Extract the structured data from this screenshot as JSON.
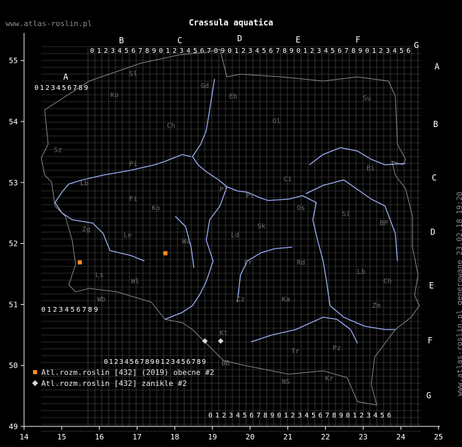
{
  "header": {
    "site": "www.atlas-roslin.pl",
    "title": "Crassula aquatica",
    "generated": "www.atlas-roslin.pl generowane 23.02.18 19:20"
  },
  "axes": {
    "lon_labels": [
      "14",
      "15",
      "16",
      "17",
      "18",
      "19",
      "20",
      "21",
      "22",
      "23",
      "24",
      "25"
    ],
    "lat_labels": [
      "49",
      "50",
      "51",
      "52",
      "53",
      "54",
      "55"
    ],
    "axis_color": "#ffffff"
  },
  "grid": {
    "color": "#5a5a5a",
    "column_letters": [
      "A",
      "B",
      "C",
      "D",
      "E",
      "F",
      "G"
    ],
    "row_letters": [
      "A",
      "B",
      "C",
      "D",
      "E",
      "F",
      "G"
    ],
    "digits": "0123456789"
  },
  "regions": [
    {
      "code": "Sl",
      "lon": 16.9,
      "lat": 54.75
    },
    {
      "code": "Gd",
      "lon": 18.8,
      "lat": 54.55
    },
    {
      "code": "Eb",
      "lon": 19.55,
      "lat": 54.38
    },
    {
      "code": "Su",
      "lon": 23.1,
      "lat": 54.35
    },
    {
      "code": "Ko",
      "lon": 16.4,
      "lat": 54.4
    },
    {
      "code": "Ol",
      "lon": 20.7,
      "lat": 53.97
    },
    {
      "code": "Ch",
      "lon": 17.9,
      "lat": 53.9
    },
    {
      "code": "Sz",
      "lon": 14.9,
      "lat": 53.5
    },
    {
      "code": "Pi",
      "lon": 16.9,
      "lat": 53.27
    },
    {
      "code": "Ci",
      "lon": 21.0,
      "lat": 53.02
    },
    {
      "code": "Bi",
      "lon": 23.2,
      "lat": 53.2
    },
    {
      "code": "Lb",
      "lon": 15.6,
      "lat": 52.95
    },
    {
      "code": "Pl",
      "lon": 19.3,
      "lat": 52.85
    },
    {
      "code": "Pt",
      "lon": 20.0,
      "lat": 52.75
    },
    {
      "code": "Fi",
      "lon": 16.9,
      "lat": 52.7
    },
    {
      "code": "Ko",
      "lon": 17.5,
      "lat": 52.55
    },
    {
      "code": "Os",
      "lon": 21.35,
      "lat": 52.55
    },
    {
      "code": "Si",
      "lon": 22.55,
      "lat": 52.45
    },
    {
      "code": "BP",
      "lon": 23.55,
      "lat": 52.3
    },
    {
      "code": "Sk",
      "lon": 20.3,
      "lat": 52.25
    },
    {
      "code": "Zg",
      "lon": 15.65,
      "lat": 52.2
    },
    {
      "code": "Le",
      "lon": 16.75,
      "lat": 52.1
    },
    {
      "code": "Ld",
      "lon": 19.6,
      "lat": 52.1
    },
    {
      "code": "Wa",
      "lon": 18.3,
      "lat": 52.0
    },
    {
      "code": "Pr",
      "lon": 19.95,
      "lat": 51.65
    },
    {
      "code": "Rd",
      "lon": 21.35,
      "lat": 51.65
    },
    {
      "code": "Lb",
      "lon": 22.95,
      "lat": 51.5
    },
    {
      "code": "Ls",
      "lon": 16.0,
      "lat": 51.45
    },
    {
      "code": "Wl",
      "lon": 16.95,
      "lat": 51.35
    },
    {
      "code": "Ch",
      "lon": 23.65,
      "lat": 51.35
    },
    {
      "code": "Wb",
      "lon": 16.05,
      "lat": 51.05
    },
    {
      "code": "Cz",
      "lon": 19.75,
      "lat": 51.05
    },
    {
      "code": "Ka",
      "lon": 20.95,
      "lat": 51.05
    },
    {
      "code": "Zm",
      "lon": 23.35,
      "lat": 50.95
    },
    {
      "code": "Kt",
      "lon": 19.3,
      "lat": 50.5
    },
    {
      "code": "Tr",
      "lon": 21.2,
      "lat": 50.2
    },
    {
      "code": "Pz",
      "lon": 22.3,
      "lat": 50.25
    },
    {
      "code": "BB",
      "lon": 19.35,
      "lat": 50.0
    },
    {
      "code": "Kr",
      "lon": 22.1,
      "lat": 49.75
    },
    {
      "code": "NS",
      "lon": 20.95,
      "lat": 49.7
    }
  ],
  "records_recent": [
    {
      "lon": 15.48,
      "lat": 51.69
    },
    {
      "lon": 17.75,
      "lat": 51.84
    }
  ],
  "records_extinct": [
    {
      "lon": 18.8,
      "lat": 50.4
    },
    {
      "lon": 19.22,
      "lat": 50.4
    }
  ],
  "colors": {
    "recent": "#ff8c1a",
    "extinct": "#d9d9d9",
    "rivers": "#9fb4ff",
    "borders": "#8a8a8a",
    "labels": "#6e6e6e"
  },
  "legend": {
    "recent": "Atl.rozm.roslin [432] (2019) obecne #2",
    "extinct": "Atl.rozm.roslin [432] zanikle #2"
  }
}
